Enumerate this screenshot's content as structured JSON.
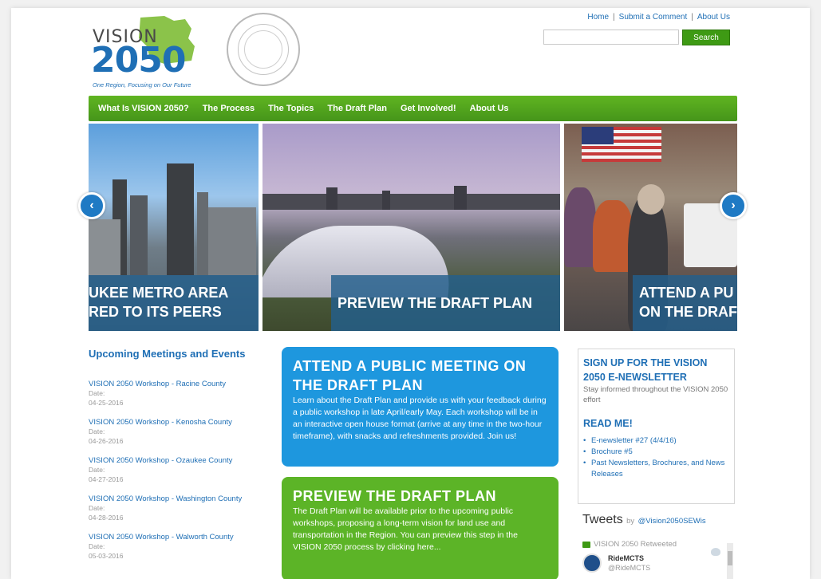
{
  "header": {
    "logo_vision": "VISION",
    "logo_year": "2050",
    "logo_tagline": "One Region, Focusing on Our Future",
    "toplinks": [
      "Home",
      "Submit a Comment",
      "About Us"
    ],
    "search_placeholder": "",
    "search_button": "Search"
  },
  "nav": {
    "items": [
      "What Is VISION 2050?",
      "The Process",
      "The Topics",
      "The Draft Plan",
      "Get Involved!",
      "About Us"
    ]
  },
  "slider": {
    "captions": [
      "UKEE METRO AREA\nRED TO ITS PEERS",
      "PREVIEW THE DRAFT PLAN",
      "ATTEND A PU\nON THE DRAF"
    ],
    "prev_arrow": "‹",
    "next_arrow": "›"
  },
  "events": {
    "heading": "Upcoming Meetings and Events",
    "date_label": "Date:",
    "items": [
      {
        "title": "VISION 2050 Workshop - Racine County",
        "date": "04-25-2016"
      },
      {
        "title": "VISION 2050 Workshop - Kenosha County",
        "date": "04-26-2016"
      },
      {
        "title": "VISION 2050 Workshop - Ozaukee County",
        "date": "04-27-2016"
      },
      {
        "title": "VISION 2050 Workshop - Washington County",
        "date": "04-28-2016"
      },
      {
        "title": "VISION 2050 Workshop - Walworth County",
        "date": "05-03-2016"
      }
    ]
  },
  "boxes": {
    "blue": {
      "title": "ATTEND A PUBLIC MEETING ON THE DRAFT PLAN",
      "body": "Learn about the Draft Plan and provide us with your feedback during a public workshop in late April/early May. Each workshop will be in an interactive open house format (arrive at any time in the two-hour timeframe), with snacks and refreshments provided. Join us!"
    },
    "green": {
      "title": "PREVIEW THE DRAFT PLAN",
      "body": "The Draft Plan will be available prior to the upcoming public workshops, proposing a long-term vision for land use and transportation in the Region. You can preview this step in the VISION 2050 process by clicking here..."
    }
  },
  "newsletter": {
    "heading": "SIGN UP FOR THE VISION 2050 E-NEWSLETTER",
    "sub": "Stay informed throughout the VISION 2050 effort",
    "readme": "READ ME!",
    "links": [
      "E-newsletter #27 (4/4/16)",
      "Brochure #5",
      "Past Newsletters, Brochures, and News Releases"
    ]
  },
  "tweets": {
    "title": "Tweets",
    "by": "by",
    "handle": "@Vision2050SEWis",
    "retweeted": "VISION 2050 Retweeted",
    "user_name": "RideMCTS",
    "user_handle": "@RideMCTS"
  },
  "colors": {
    "nav_green": "#4fa31c",
    "link_blue": "#1f6fb5",
    "box_blue": "#1e97de",
    "box_green": "#5cb427"
  }
}
